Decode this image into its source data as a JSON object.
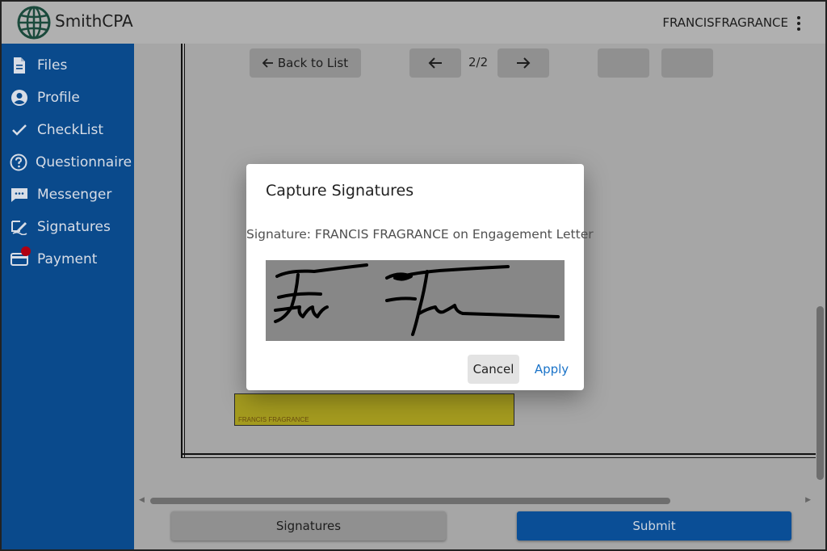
{
  "header": {
    "brand": "SmithCPA",
    "username": "FRANCISFRAGRANCE"
  },
  "sidebar": {
    "items": [
      {
        "label": "Files",
        "icon": "file-icon"
      },
      {
        "label": "Profile",
        "icon": "user-circle-icon"
      },
      {
        "label": "CheckList",
        "icon": "checkmark-icon"
      },
      {
        "label": "Questionnaire",
        "icon": "question-circle-icon"
      },
      {
        "label": "Messenger",
        "icon": "chat-icon"
      },
      {
        "label": "Signatures",
        "icon": "signature-icon"
      },
      {
        "label": "Payment",
        "icon": "credit-card-icon"
      }
    ]
  },
  "toolbar": {
    "back_label": "Back to List",
    "page_indicator": "2/2"
  },
  "document": {
    "signature_field_label": "FRANCIS FRAGRANCE"
  },
  "footer": {
    "signatures_label": "Signatures",
    "submit_label": "Submit"
  },
  "modal": {
    "title": "Capture Signatures",
    "subtitle": "Signature: FRANCIS FRAGRANCE on Engagement Letter",
    "cancel_label": "Cancel",
    "apply_label": "Apply"
  },
  "colors": {
    "sidebar_bg": "#0a4a8c",
    "submit_bg": "#0a4e96",
    "apply_text": "#1a73c8",
    "signature_field": "#a49b1f",
    "notification_dot": "#b00012"
  }
}
